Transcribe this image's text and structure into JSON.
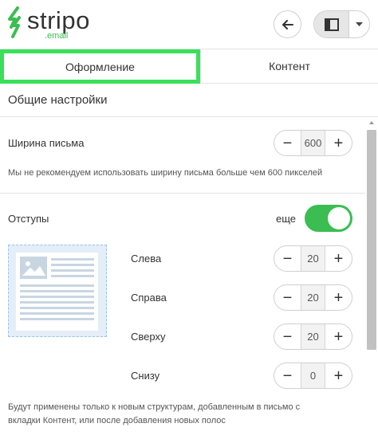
{
  "brand": {
    "name": "stripo",
    "sub": ".email",
    "accent": "#3bbd52"
  },
  "header": {
    "back_icon": "arrow-left-icon",
    "layout_icon": "layout-panel-icon",
    "dropdown_icon": "chevron-down-icon"
  },
  "tabs": [
    {
      "label": "Оформление",
      "active": true
    },
    {
      "label": "Контент",
      "active": false
    }
  ],
  "section": {
    "title": "Общие настройки"
  },
  "email_width": {
    "label": "Ширина письма",
    "value": "600",
    "minus": "−",
    "plus": "+",
    "note": "Мы не рекомендуем использовать ширину письма больше чем 600 пикселей"
  },
  "padding": {
    "label": "Отступы",
    "toggle_label": "еще",
    "toggle_on": true,
    "fields": [
      {
        "label": "Слева",
        "value": "20"
      },
      {
        "label": "Справа",
        "value": "20"
      },
      {
        "label": "Сверху",
        "value": "20"
      },
      {
        "label": "Снизу",
        "value": "0"
      }
    ],
    "note_line1": "Будут применены только к новым структурам, добавленным в письмо с",
    "note_line2": "вкладки Контент, или после добавления новых полос"
  }
}
